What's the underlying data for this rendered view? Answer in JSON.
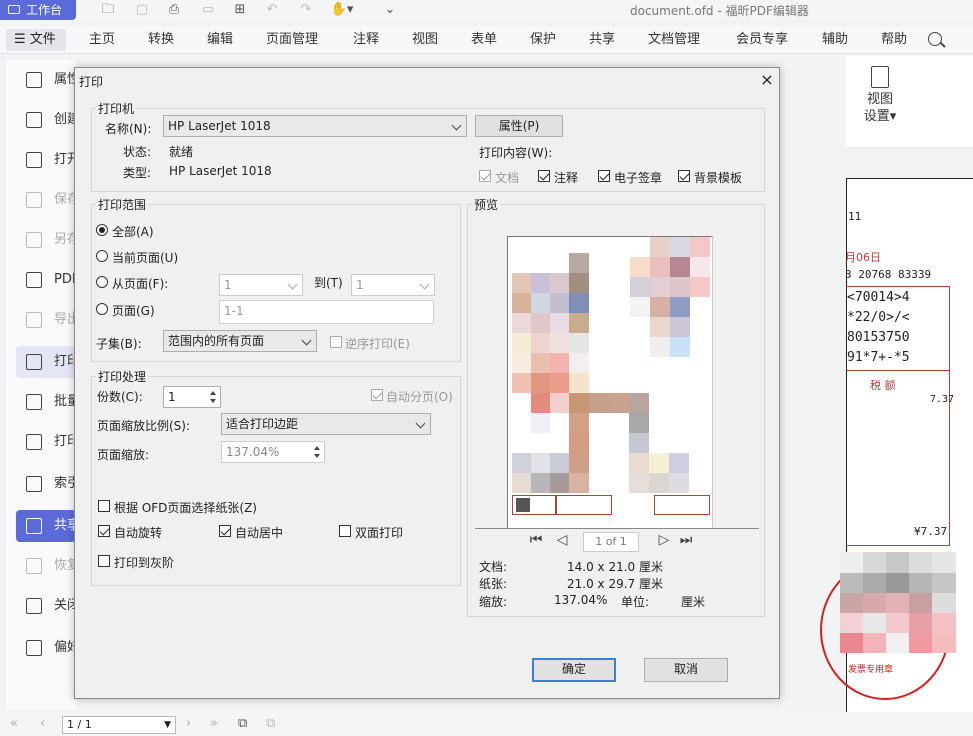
{
  "app": {
    "button_label": "工作台",
    "doc_title": "document.ofd - 福昕PDF编辑器"
  },
  "menubar": {
    "file": "文件",
    "items": [
      "主页",
      "转换",
      "编辑",
      "页面管理",
      "注释",
      "视图",
      "表单",
      "保护",
      "共享",
      "文档管理",
      "会员专享",
      "辅助",
      "帮助"
    ]
  },
  "sidebar": {
    "items": [
      "属性",
      "创建",
      "打开",
      "保存",
      "另存",
      "PDF",
      "导出",
      "打印",
      "批量",
      "打印",
      "索引",
      "共享",
      "恢复",
      "关闭",
      "偏好"
    ]
  },
  "ribbon": {
    "view_settings": "视图\n设置▾"
  },
  "status": {
    "page": "1 / 1"
  },
  "background_doc": {
    "lines": [
      "11",
      "月06日",
      "3 20768 83339",
      "<70014>4",
      "*22/0>/<",
      "80153750",
      "91*7+-*5"
    ],
    "tax_label": "税 额",
    "amount1": "7.37",
    "amount2": "¥7.37",
    "stamp_text": "发票专用章"
  },
  "dialog": {
    "title": "打印",
    "close": "×",
    "printer": {
      "legend": "打印机",
      "name_label": "名称(N):",
      "name_value": "HP LaserJet 1018",
      "properties_btn": "属性(P)",
      "status_label": "状态:",
      "status_value": "就绪",
      "type_label": "类型:",
      "type_value": "HP LaserJet 1018",
      "content_label": "打印内容(W):",
      "content_options": [
        {
          "label": "文档",
          "checked": true,
          "disabled": true
        },
        {
          "label": "注释",
          "checked": true,
          "disabled": false
        },
        {
          "label": "电子签章",
          "checked": true,
          "disabled": false
        },
        {
          "label": "背景模板",
          "checked": true,
          "disabled": false
        }
      ]
    },
    "range": {
      "legend": "打印范围",
      "all": "全部(A)",
      "current": "当前页面(U)",
      "from": "从页面(F):",
      "from_value": "1",
      "to": "到(T)",
      "to_value": "1",
      "pages": "页面(G)",
      "pages_value": "1-1",
      "subset_label": "子集(B):",
      "subset_value": "范围内的所有页面",
      "reverse": "逆序打印(E)"
    },
    "handling": {
      "legend": "打印处理",
      "copies_label": "份数(C):",
      "copies_value": "1",
      "collate": "自动分页(O)",
      "scale_label": "页面缩放比例(S):",
      "scale_value": "适合打印边距",
      "zoom_label": "页面缩放:",
      "zoom_value": "137.04%",
      "paper_by_ofd": "根据 OFD页面选择纸张(Z)",
      "auto_rotate": "自动旋转",
      "auto_center": "自动居中",
      "duplex": "双面打印",
      "grayscale": "打印到灰阶"
    },
    "preview": {
      "legend": "预览",
      "page_indicator": "1 of 1",
      "doc_label": "文档:",
      "doc_value": "14.0 x 21.0 厘米",
      "paper_label": "纸张:",
      "paper_value": "21.0 x 29.7 厘米",
      "zoom_label": "缩放:",
      "zoom_value": "137.04%",
      "unit_label": "单位:",
      "unit_value": "厘米"
    },
    "ok": "确定",
    "cancel": "取消"
  }
}
